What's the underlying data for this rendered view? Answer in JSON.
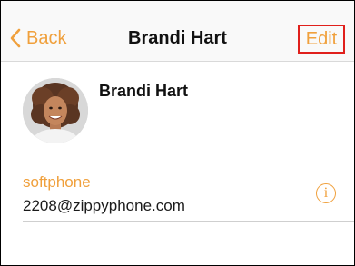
{
  "navbar": {
    "back_label": "Back",
    "title": "Brandi Hart",
    "edit_label": "Edit",
    "back_icon": "chevron-left-icon"
  },
  "contact": {
    "name": "Brandi Hart",
    "avatar": "avatar-photo"
  },
  "phones": [
    {
      "type": "softphone",
      "number": "2208@zippyphone.com",
      "info_icon": "info-icon"
    }
  ],
  "colors": {
    "accent": "#f0a03c",
    "edit_highlight": "#e0201c",
    "navbar_bg": "#f9f9f9",
    "text": "#111111"
  }
}
